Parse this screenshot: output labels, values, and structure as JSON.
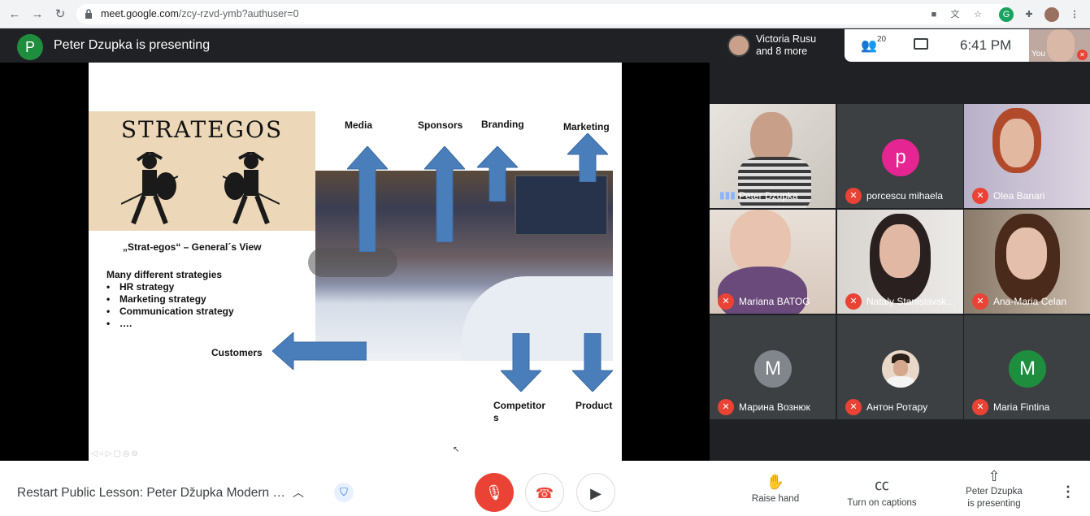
{
  "browser": {
    "url_host": "meet.google.com",
    "url_path": "/zcy-rzvd-ymb?authuser=0"
  },
  "meet": {
    "presenter_initial": "P",
    "presenting_title": "Peter Dzupka is presenting",
    "chip_name_line1": "Victoria Rusu",
    "chip_name_line2": "and 8 more",
    "people_count": "20",
    "clock": "6:41 PM",
    "you_label": "You"
  },
  "slide": {
    "brand_title": "STRATEGOS",
    "general_view": "„Strat-egos“ – General´s View",
    "many": "Many different strategies",
    "bullets": [
      "HR strategy",
      "Marketing strategy",
      "Communication strategy",
      "…."
    ],
    "labels": {
      "media": "Media",
      "sponsors": "Sponsors",
      "branding": "Branding",
      "marketing": "Marketing",
      "customers": "Customers",
      "competitors_line1": "Competitor",
      "competitors_line2": "s",
      "product": "Product"
    },
    "arrow_color": "#4a7ebb"
  },
  "participants": [
    {
      "name": "Peter Dzupka",
      "status": "speaking",
      "type": "video"
    },
    {
      "name": "porcescu mihaela",
      "status": "muted",
      "type": "avatar",
      "initial": "p",
      "color": "#e52592"
    },
    {
      "name": "Olea Banari",
      "status": "muted",
      "type": "video"
    },
    {
      "name": "Mariana BATOG",
      "status": "muted",
      "type": "video"
    },
    {
      "name": "Nataly Stanislavsk…",
      "status": "muted",
      "type": "video"
    },
    {
      "name": "Ana-Maria Celan",
      "status": "muted",
      "type": "video"
    },
    {
      "name": "Марина Вознюк",
      "status": "muted",
      "type": "avatar",
      "initial": "M",
      "color": "#80868b"
    },
    {
      "name": "Антон Ротару",
      "status": "muted",
      "type": "photo-avatar"
    },
    {
      "name": "Maria Fintina",
      "status": "muted",
      "type": "avatar",
      "initial": "M",
      "color": "#1e8e3e"
    }
  ],
  "bottom": {
    "meeting_title": "Restart Public Lesson: Peter Džupka Modern …",
    "raise_hand": "Raise hand",
    "captions": "Turn on captions",
    "presenting_line1": "Peter Dzupka",
    "presenting_line2": "is presenting"
  }
}
